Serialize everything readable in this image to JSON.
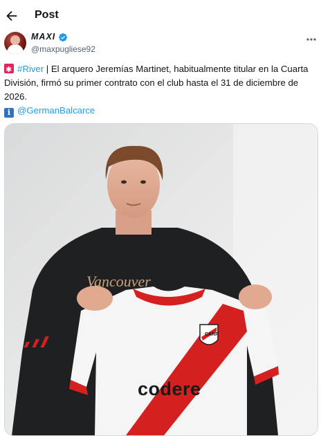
{
  "header": {
    "title": "Post",
    "back_icon": "arrow-left-icon"
  },
  "author": {
    "display_name": "MAXI",
    "handle": "@maxpugliese92",
    "verified_icon": "verified-badge-icon",
    "more_icon": "more-horizontal-icon"
  },
  "tweet": {
    "hashtag": "#River",
    "text_after_hashtag": " | El arquero Jeremías Martinet, habitualmente titular en la Cuarta División, firmó su primer contrato con el club hasta el 31 de diciembre de 2026.",
    "source_mention": "@GermanBalcarce",
    "siren_icon": "rotating-light-emoji",
    "info_icon": "information-emoji"
  },
  "media": {
    "jersey_sponsor": "codere",
    "sweater_text": "Vancouver"
  },
  "colors": {
    "link": "#1d9bf0",
    "text": "#0f1419",
    "secondary": "#536471",
    "jersey_red": "#d4201f",
    "verified": "#1d9bf0"
  }
}
